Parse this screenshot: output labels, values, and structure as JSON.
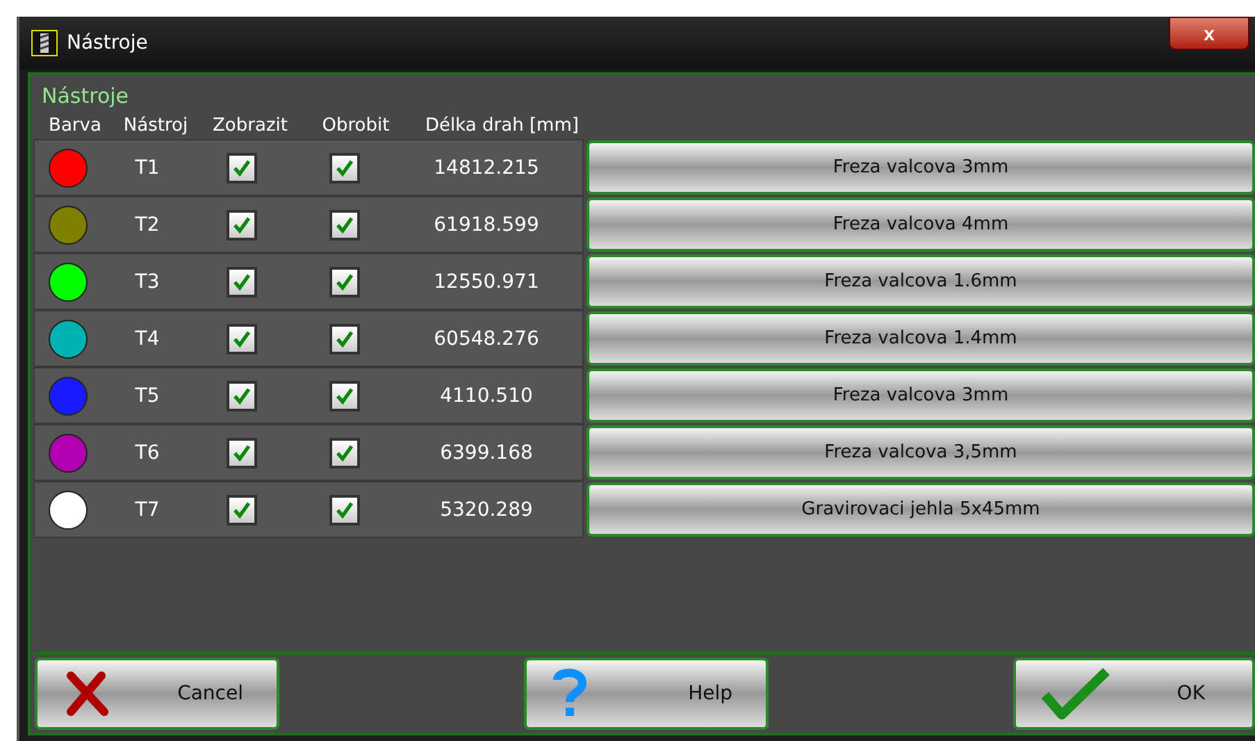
{
  "window": {
    "title": "Nástroje",
    "close": "x"
  },
  "group_title": "Nástroje",
  "table": {
    "columns": [
      "Barva",
      "Nástroj",
      "Zobrazit",
      "Obrobit",
      "Délka drah [mm]"
    ],
    "rows": [
      {
        "color": "#ff0000",
        "tool": "T1",
        "show": true,
        "machine": true,
        "length": "14812.215",
        "name": "Freza valcova 3mm"
      },
      {
        "color": "#808000",
        "tool": "T2",
        "show": true,
        "machine": true,
        "length": "61918.599",
        "name": "Freza valcova 4mm"
      },
      {
        "color": "#00ff00",
        "tool": "T3",
        "show": true,
        "machine": true,
        "length": "12550.971",
        "name": "Freza valcova 1.6mm"
      },
      {
        "color": "#00b3b3",
        "tool": "T4",
        "show": true,
        "machine": true,
        "length": "60548.276",
        "name": "Freza valcova 1.4mm"
      },
      {
        "color": "#1a1aff",
        "tool": "T5",
        "show": true,
        "machine": true,
        "length": "4110.510",
        "name": "Freza valcova 3mm"
      },
      {
        "color": "#b000b0",
        "tool": "T6",
        "show": true,
        "machine": true,
        "length": "6399.168",
        "name": "Freza valcova 3,5mm"
      },
      {
        "color": "#ffffff",
        "tool": "T7",
        "show": true,
        "machine": true,
        "length": "5320.289",
        "name": "Gravirovaci jehla 5x45mm"
      }
    ]
  },
  "buttons": [
    {
      "kind": "cancel",
      "label": "Cancel"
    },
    {
      "kind": "help",
      "label": "Help"
    },
    {
      "kind": "ok",
      "label": "OK"
    }
  ]
}
